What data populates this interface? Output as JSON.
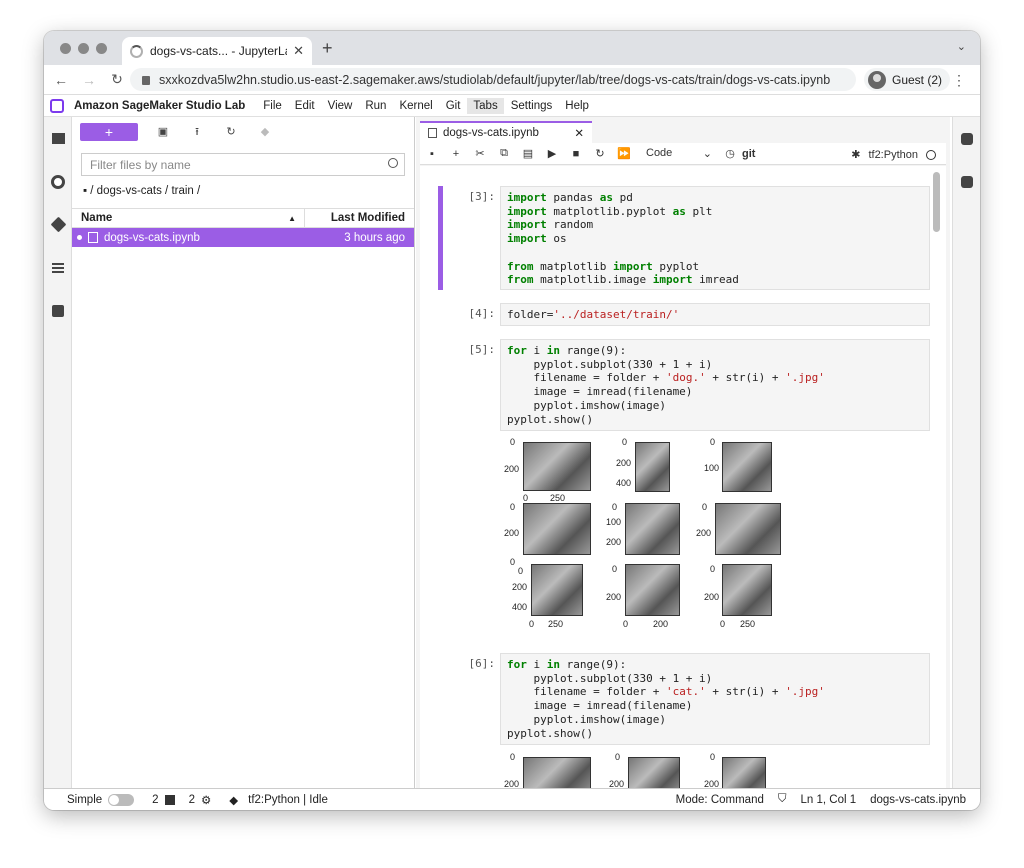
{
  "browser": {
    "tab_title": "dogs-vs-cats... - JupyterLab",
    "url": "sxxkozdva5lw2hn.studio.us-east-2.sagemaker.aws/studiolab/default/jupyter/lab/tree/dogs-vs-cats/train/dogs-vs-cats.ipynb",
    "profile": "Guest (2)"
  },
  "menubar": {
    "brand": "Amazon SageMaker Studio Lab",
    "items": [
      "File",
      "Edit",
      "View",
      "Run",
      "Kernel",
      "Git",
      "Tabs",
      "Settings",
      "Help"
    ]
  },
  "filebrowser": {
    "new_label": "+",
    "filter_placeholder": "Filter files by name",
    "breadcrumb": "/ dogs-vs-cats / train /",
    "col_name": "Name",
    "col_modified": "Last Modified",
    "files": [
      {
        "name": "dogs-vs-cats.ipynb",
        "modified": "3 hours ago"
      }
    ]
  },
  "notebook": {
    "tab_title": "dogs-vs-cats.ipynb",
    "cell_type": "Code",
    "git_label": "git",
    "kernel": "tf2:Python",
    "cells": [
      {
        "prompt": "[3]:"
      },
      {
        "prompt": "[4]:"
      },
      {
        "prompt": "[5]:"
      },
      {
        "prompt": "[6]:"
      }
    ],
    "figure_ticks": {
      "row1_col1": [
        "0",
        "200",
        "0",
        "250"
      ],
      "row1_col2": [
        "0",
        "200",
        "400"
      ],
      "row1_col3": [
        "0",
        "100"
      ],
      "row2_col1": [
        "0",
        "200",
        "0"
      ],
      "row2_col2": [
        "0",
        "100",
        "200"
      ],
      "row2_col3": [
        "0",
        "200"
      ],
      "row3_col1": [
        "0",
        "200",
        "400",
        "0",
        "250"
      ],
      "row3_col2": [
        "0",
        "200",
        "0",
        "200"
      ],
      "row3_col3": [
        "0",
        "200",
        "0",
        "250"
      ],
      "fig2_ticks": [
        "0",
        "200",
        "0",
        "200",
        "0",
        "200"
      ]
    }
  },
  "status": {
    "mode_label": "Simple",
    "count1": "2",
    "count2": "2",
    "kernel_status": "tf2:Python | Idle",
    "mode": "Mode: Command",
    "position": "Ln 1, Col 1",
    "file": "dogs-vs-cats.ipynb"
  }
}
